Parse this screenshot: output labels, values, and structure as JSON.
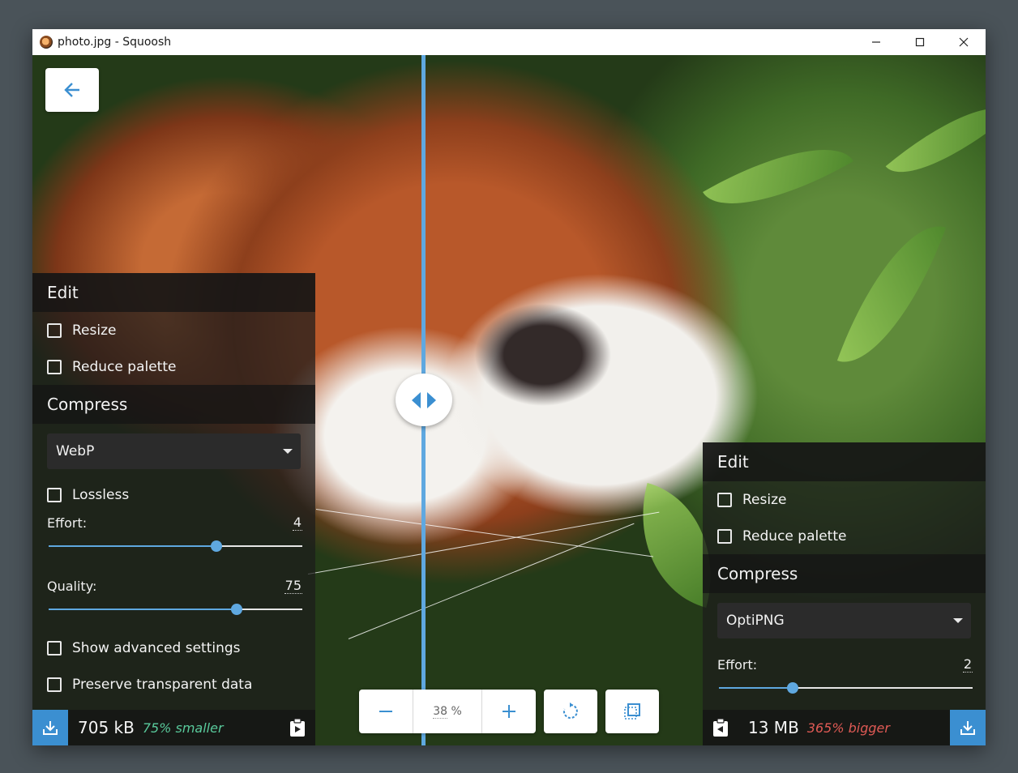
{
  "window": {
    "title": "photo.jpg - Squoosh",
    "minimize_icon": "minimize-icon",
    "maximize_icon": "maximize-icon",
    "close_icon": "close-icon"
  },
  "back_button": {
    "icon": "arrow-left-icon"
  },
  "left_panel": {
    "edit_heading": "Edit",
    "resize_label": "Resize",
    "reduce_palette_label": "Reduce palette",
    "compress_heading": "Compress",
    "codec": "WebP",
    "lossless_label": "Lossless",
    "effort_label": "Effort:",
    "effort_value": "4",
    "effort_fraction": 0.66,
    "quality_label": "Quality:",
    "quality_value": "75",
    "quality_fraction": 0.74,
    "advanced_label": "Show advanced settings",
    "preserve_label": "Preserve transparent data",
    "size": "705 kB",
    "delta": "75% smaller"
  },
  "right_panel": {
    "edit_heading": "Edit",
    "resize_label": "Resize",
    "reduce_palette_label": "Reduce palette",
    "compress_heading": "Compress",
    "codec": "OptiPNG",
    "effort_label": "Effort:",
    "effort_value": "2",
    "effort_fraction": 0.29,
    "size": "13 MB",
    "delta": "365% bigger"
  },
  "zoom": {
    "value": "38",
    "unit": "%",
    "zoom_out_icon": "minus-icon",
    "zoom_in_icon": "plus-icon",
    "rotate_icon": "rotate-icon",
    "background_toggle_icon": "background-toggle-icon"
  },
  "colors": {
    "accent": "#5fa8e0",
    "download_button": "#3b8fd1",
    "smaller": "#59c99b",
    "bigger": "#e05a55"
  }
}
